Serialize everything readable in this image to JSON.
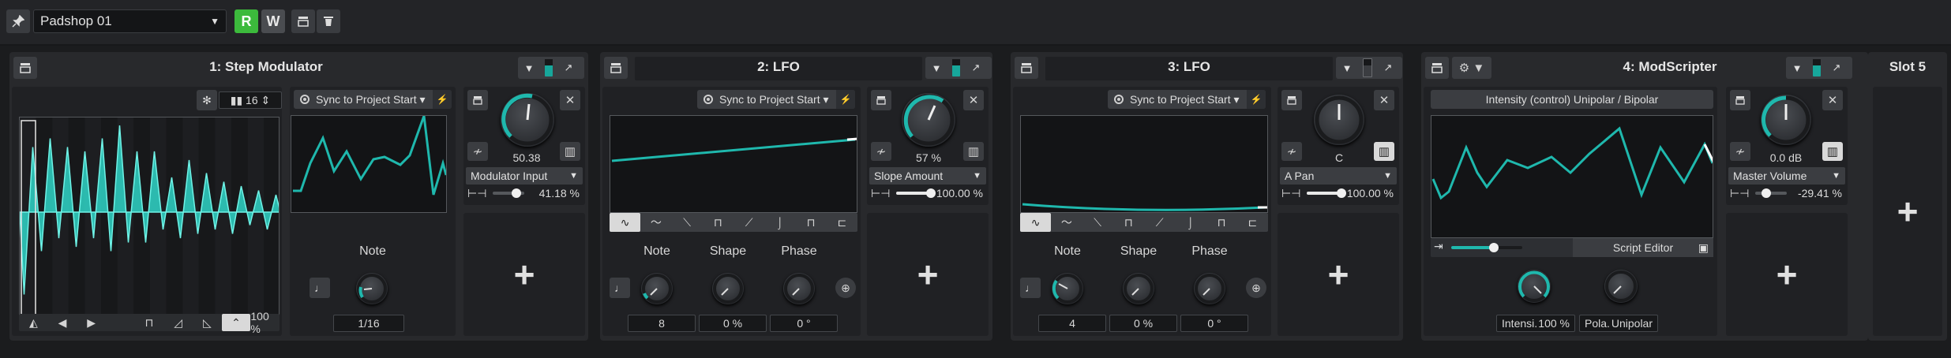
{
  "topbar": {
    "preset_name": "Padshop 01",
    "read_label": "R",
    "write_label": "W"
  },
  "modulators": [
    {
      "title": "1: Step Modulator",
      "steps_value": "16",
      "sync_label": "Sync to Project Start",
      "depth_value": "50.38",
      "destination": "Modulator Input",
      "amount": "41.18 %",
      "note_label": "Note",
      "note_value": "1/16",
      "swing_value": "100 %"
    },
    {
      "title": "2: LFO",
      "sync_label": "Sync to Project Start",
      "depth_value": "57 %",
      "destination": "Slope Amount",
      "amount": "100.00 %",
      "note_label": "Note",
      "note_value": "8",
      "shape_label": "Shape",
      "shape_value": "0 %",
      "phase_label": "Phase",
      "phase_value": "0 °"
    },
    {
      "title": "3: LFO",
      "sync_label": "Sync to Project Start",
      "depth_value": "C",
      "destination": "A Pan",
      "amount": "100.00 %",
      "note_label": "Note",
      "note_value": "4",
      "shape_label": "Shape",
      "shape_value": "0 %",
      "phase_label": "Phase",
      "phase_value": "0 °"
    },
    {
      "title": "4: ModScripter",
      "display_title": "Intensity (control) Unipolar / Bipolar",
      "script_editor_label": "Script Editor",
      "depth_value": "0.0 dB",
      "destination": "Master Volume",
      "amount": "-29.41 %",
      "param1_label": "Intensi.",
      "param1_value": "100 %",
      "param2_label": "Pola.",
      "param2_value": "Unipolar",
      "slider_fraction": 0.6
    }
  ],
  "slot5": {
    "title": "Slot 5"
  },
  "colors": {
    "accent": "#1fb8ad",
    "record": "#3cba3c",
    "panel": "#28292c"
  }
}
